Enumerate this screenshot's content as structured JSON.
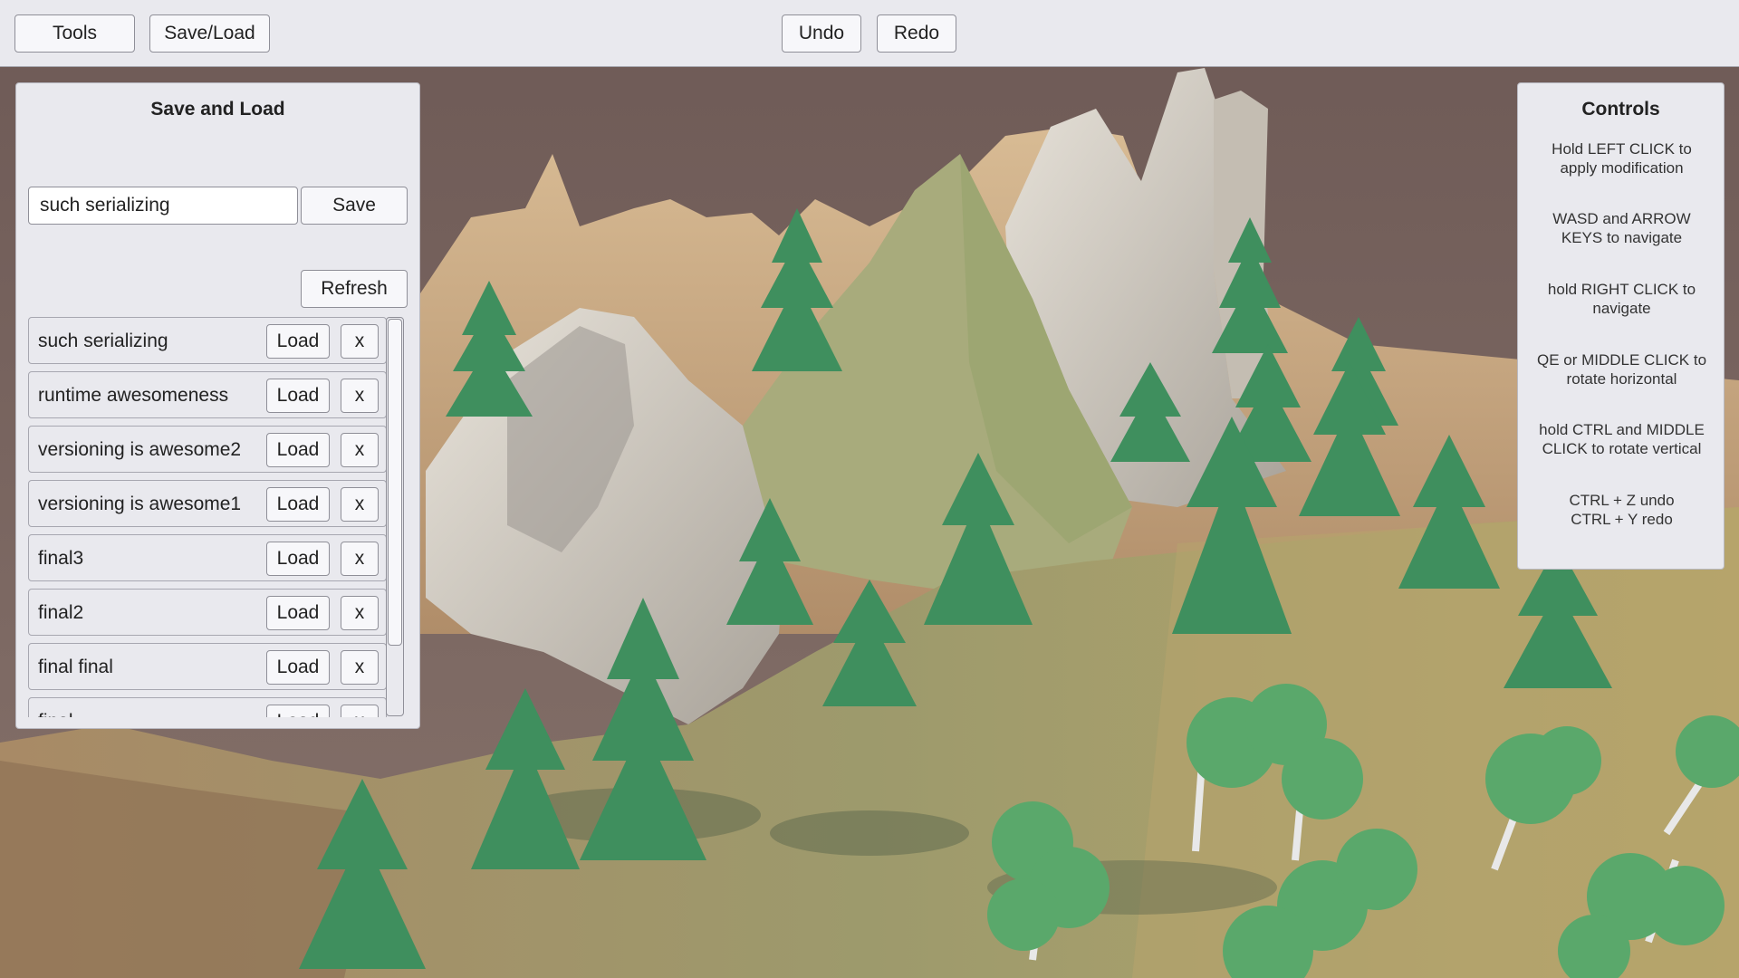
{
  "toolbar": {
    "tools_label": "Tools",
    "saveload_label": "Save/Load",
    "undo_label": "Undo",
    "redo_label": "Redo"
  },
  "save_panel": {
    "title": "Save and Load",
    "input_value": "such serializing",
    "save_label": "Save",
    "refresh_label": "Refresh",
    "load_label": "Load",
    "delete_label": "x",
    "items": [
      "such serializing",
      "runtime awesomeness",
      "versioning is awesome2",
      "versioning is awesome1",
      "final3",
      "final2",
      "final final",
      "final"
    ]
  },
  "controls_panel": {
    "title": "Controls",
    "lines": [
      "Hold LEFT CLICK to\napply modification",
      "WASD and ARROW\nKEYS to navigate",
      "hold RIGHT CLICK to\nnavigate",
      "QE or MIDDLE CLICK to\nrotate horizontal",
      "hold CTRL and MIDDLE\nCLICK to rotate vertical",
      "CTRL + Z undo\nCTRL + Y redo"
    ]
  },
  "colors": {
    "sky": "#79645e",
    "rock_light": "#d9d4cc",
    "rock_tan": "#c9ab86",
    "grass": "#8ea56f",
    "pine": "#3f8f5e",
    "birch_leaf": "#5aa86b",
    "ui_bg": "#e9e9ee"
  },
  "scene": {
    "view": "3D terrain editor view",
    "icon": "terrain-scene"
  }
}
